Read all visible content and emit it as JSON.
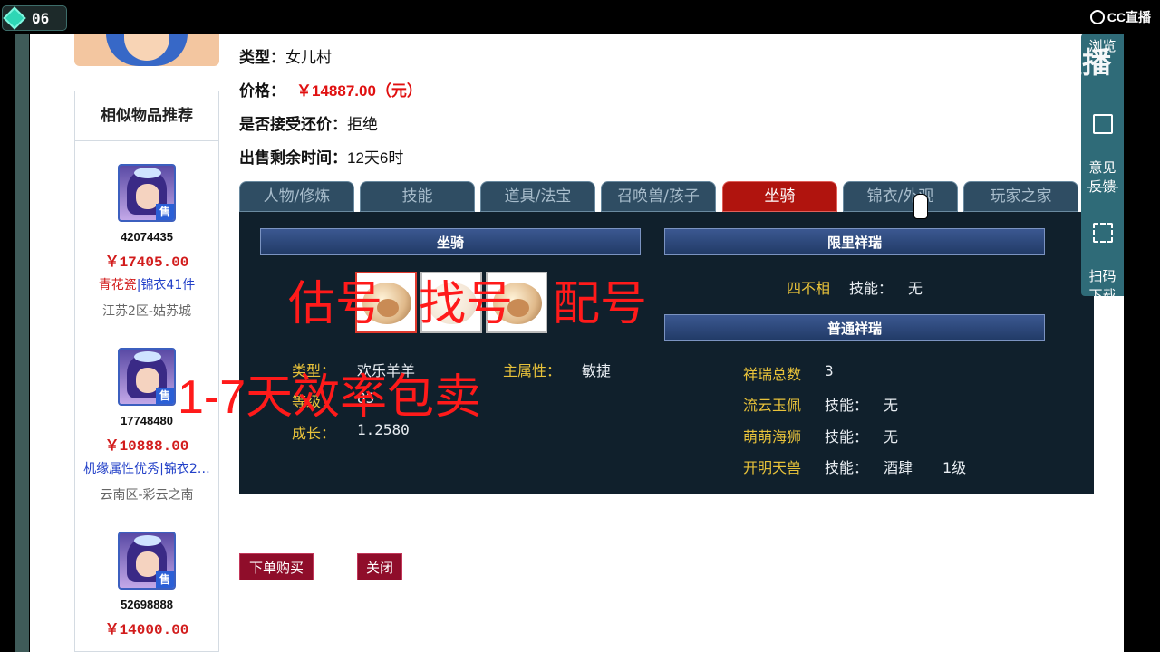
{
  "topbar": {
    "level": "06",
    "brand": "CC直播"
  },
  "watermark": {
    "brand": "CC直播"
  },
  "side_widget": {
    "browse": "浏览",
    "feedback": "意见\n反馈",
    "scan": "扫码\n下载"
  },
  "rec": {
    "title": "相似物品推荐",
    "sell_tag": "售",
    "items": [
      {
        "id": "42074435",
        "price": "￥17405.00",
        "tag_a": "青花瓷",
        "tag_b": "锦衣41件",
        "server": "江苏2区-姑苏城"
      },
      {
        "id": "17748480",
        "price": "￥10888.00",
        "tag_a": "机缘属性优秀",
        "tag_b": "锦衣2…",
        "server": "云南区-彩云之南"
      },
      {
        "id": "52698888",
        "price": "￥14000.00",
        "tag_a": "",
        "tag_b": "",
        "server": ""
      }
    ]
  },
  "info": {
    "type_label": "类型：",
    "type_value": "女儿村",
    "price_label": "价格：",
    "price_value": "￥14887.00（元）",
    "bargain_label": "是否接受还价：",
    "bargain_value": "拒绝",
    "time_label": "出售剩余时间：",
    "time_value": "12天6时"
  },
  "tabs": [
    "人物/修炼",
    "技能",
    "道具/法宝",
    "召唤兽/孩子",
    "坐骑",
    "锦衣/外观",
    "玩家之家"
  ],
  "panel": {
    "mount_header": "坐骑",
    "limit_header": "限里祥瑞",
    "normal_header": "普通祥瑞",
    "limit_item": {
      "name": "四不相",
      "skill_label": "技能：",
      "skill_value": "无"
    },
    "mount_type_label": "类型：",
    "mount_type_value": "欢乐羊羊",
    "level_label": "等级：",
    "level_value": "85",
    "growth_label": "成长：",
    "growth_value": "1.2580",
    "main_attr_label": "主属性：",
    "main_attr_value": "敏捷",
    "total_label": "祥瑞总数",
    "total_value": "3",
    "normal_items": [
      {
        "name": "流云玉佩",
        "skill_label": "技能：",
        "skill_value": "无",
        "extra": ""
      },
      {
        "name": "萌萌海狮",
        "skill_label": "技能：",
        "skill_value": "无",
        "extra": ""
      },
      {
        "name": "开明天兽",
        "skill_label": "技能：",
        "skill_value": "酒肆",
        "extra": "1级"
      }
    ]
  },
  "buttons": {
    "buy": "下单购买",
    "close": "关闭"
  },
  "overlay": {
    "line1_a": "估号",
    "line1_b": "找号",
    "line1_c": "配号",
    "line2": "1-7天效率包卖"
  }
}
